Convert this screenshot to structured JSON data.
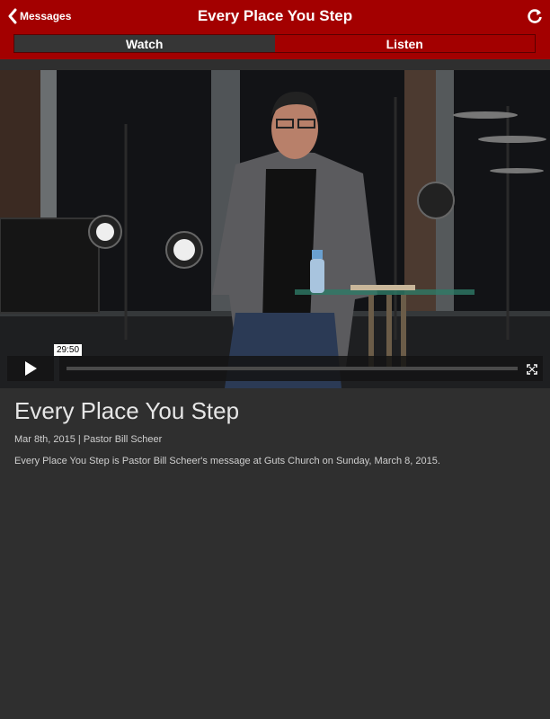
{
  "nav": {
    "back_label": "Messages",
    "title": "Every Place You Step",
    "refresh_icon": "refresh-icon",
    "back_icon": "chevron-left-icon"
  },
  "tabs": [
    {
      "label": "Watch",
      "active": true
    },
    {
      "label": "Listen",
      "active": false
    }
  ],
  "player": {
    "duration": "29:50",
    "progress": 0.0,
    "play_icon": "play-icon",
    "fullscreen_icon": "fullscreen-icon"
  },
  "message": {
    "title": "Every Place You Step",
    "meta": "Mar 8th, 2015 | Pastor Bill Scheer",
    "description": "Every Place You Step is Pastor Bill Scheer's message at Guts Church on Sunday, March 8, 2015."
  },
  "colors": {
    "brand": "#a30000",
    "background": "#2f2f2f",
    "active_tab": "#363636"
  }
}
